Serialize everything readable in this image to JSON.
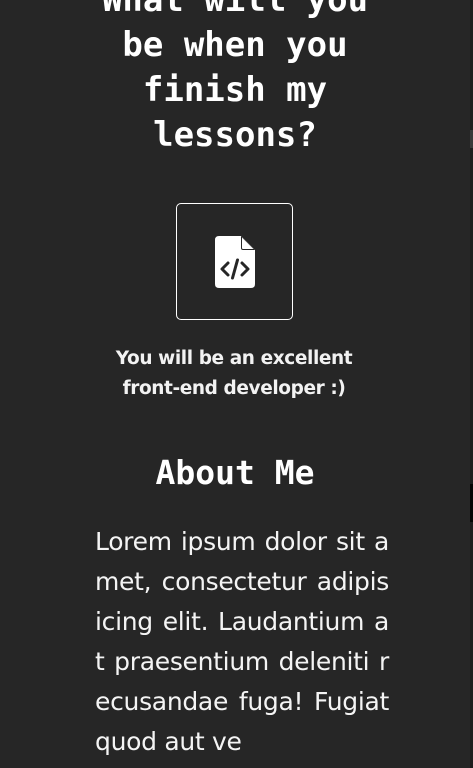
{
  "question": {
    "heading": "What will you be when you finish my lessons?"
  },
  "result": {
    "icon": "file-code-icon",
    "caption": "You will be an excellent front-end developer :)"
  },
  "about": {
    "title": "About Me",
    "text": "Lorem ipsum dolor sit amet, consectetur adipisicing elit. Laudantium at praesentium deleniti recusandae fuga! Fugiat quod aut ve"
  },
  "colors": {
    "background": "#262626",
    "foreground": "#ffffff"
  }
}
